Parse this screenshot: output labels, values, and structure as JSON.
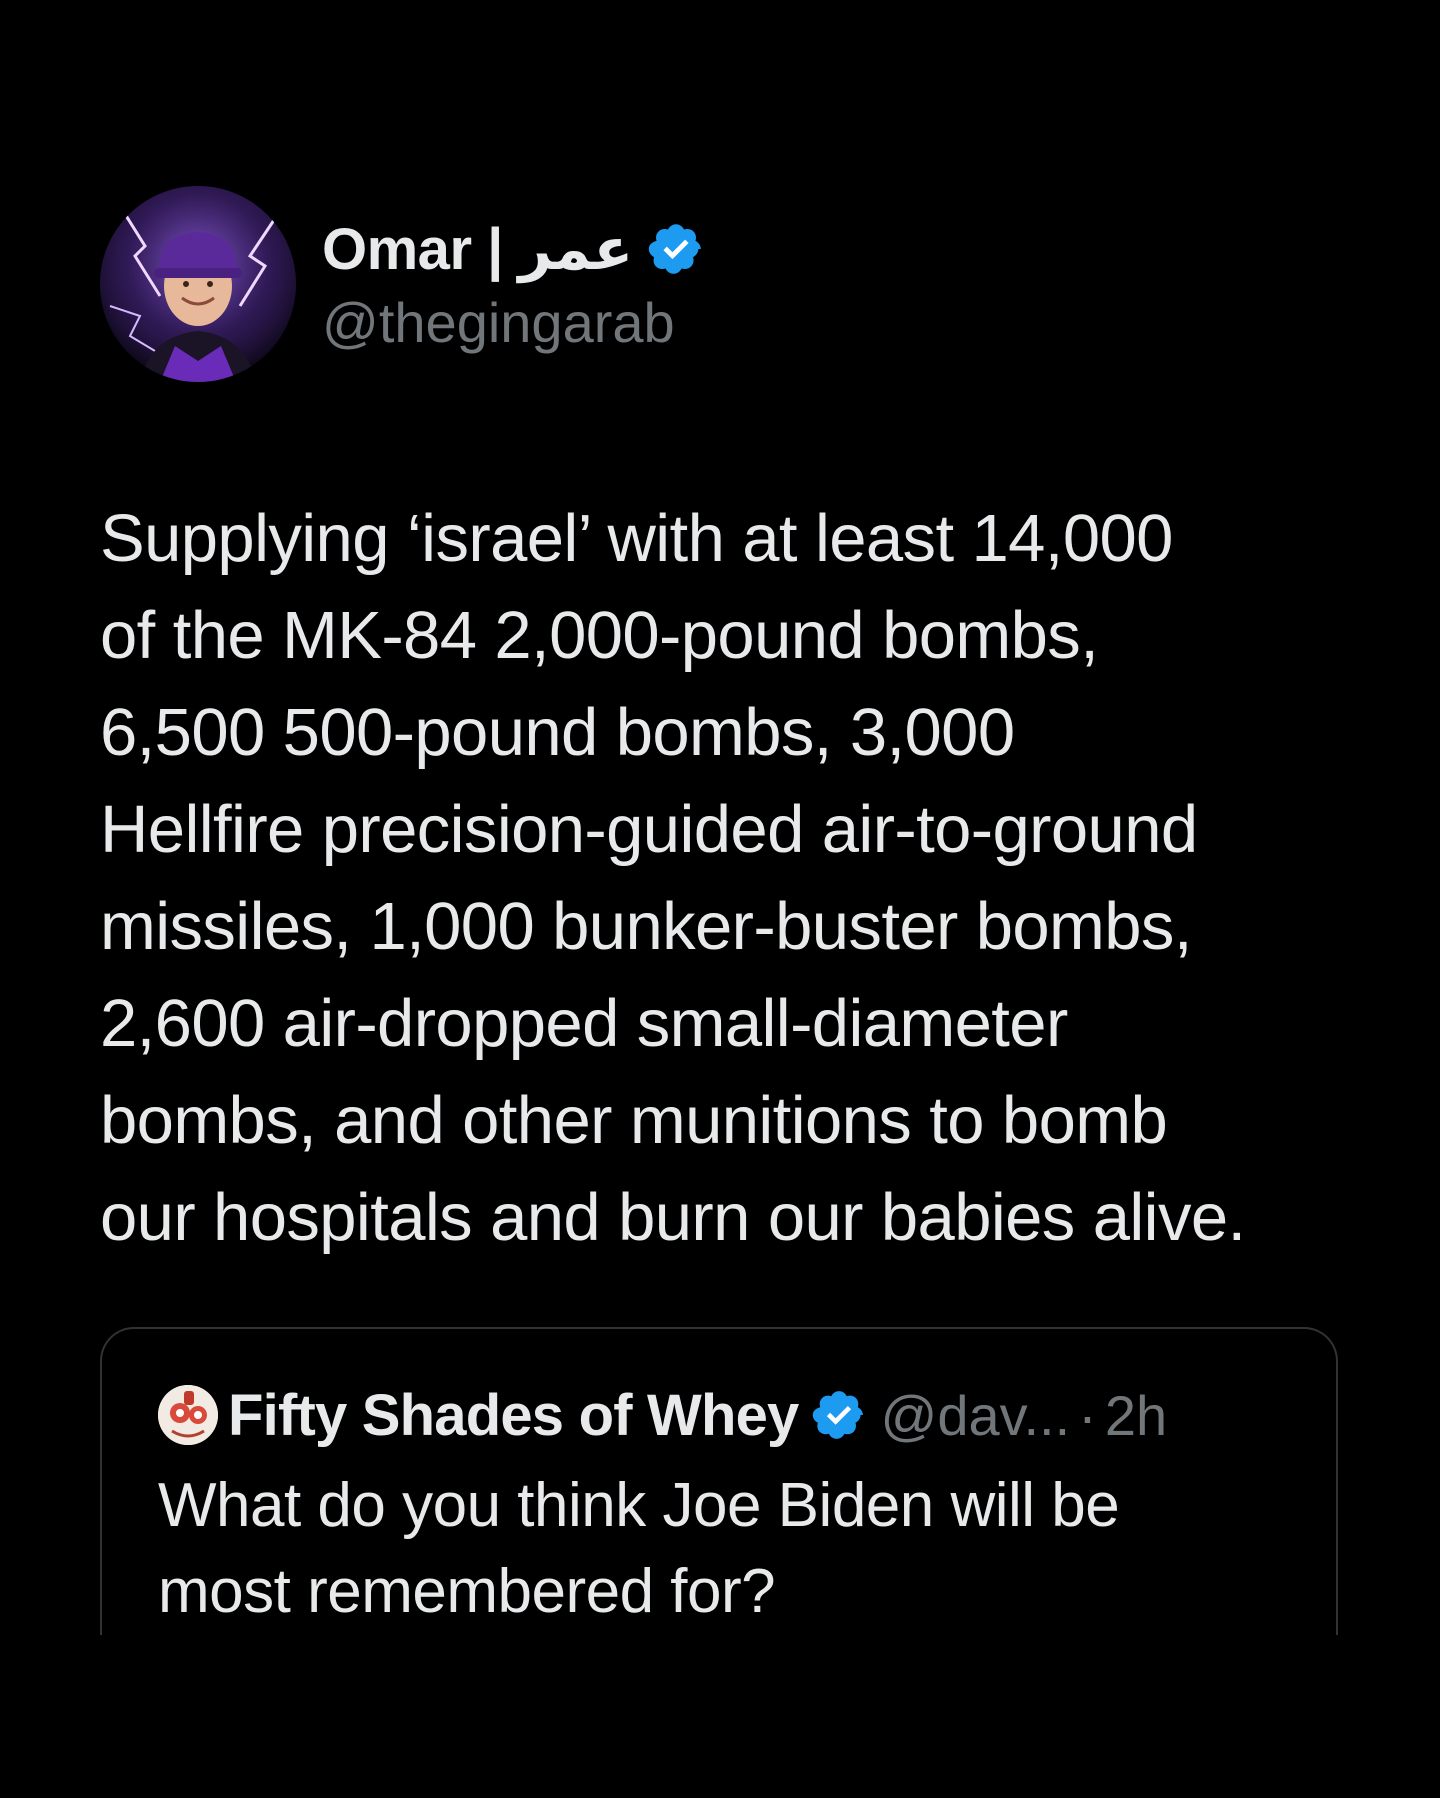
{
  "author": {
    "display_name": "Omar | عمر",
    "handle": "@thegingarab",
    "verified": true,
    "avatar": "profile-photo"
  },
  "tweet": {
    "text": "Supplying ‘israel’ with at least 14,000\nof the MK-84 2,000-pound bombs,\n6,500 500-pound bombs, 3,000\nHellfire precision-guided air-to-ground\nmissiles, 1,000 bunker-buster bombs,\n2,600 air-dropped small-diameter\nbombs, and other munitions to bomb\nour hospitals and burn our babies alive."
  },
  "quoted_tweet": {
    "display_name": "Fifty Shades of Whey",
    "handle": "@dav...",
    "separator": "·",
    "time": "2h",
    "verified": true,
    "text": "What do you think Joe Biden will be\nmost remembered for?"
  },
  "colors": {
    "background": "#000000",
    "primary_text": "#e7e9ea",
    "secondary_text": "#71767b",
    "verified_blue": "#1d9bf0",
    "card_border": "#2f3336"
  }
}
